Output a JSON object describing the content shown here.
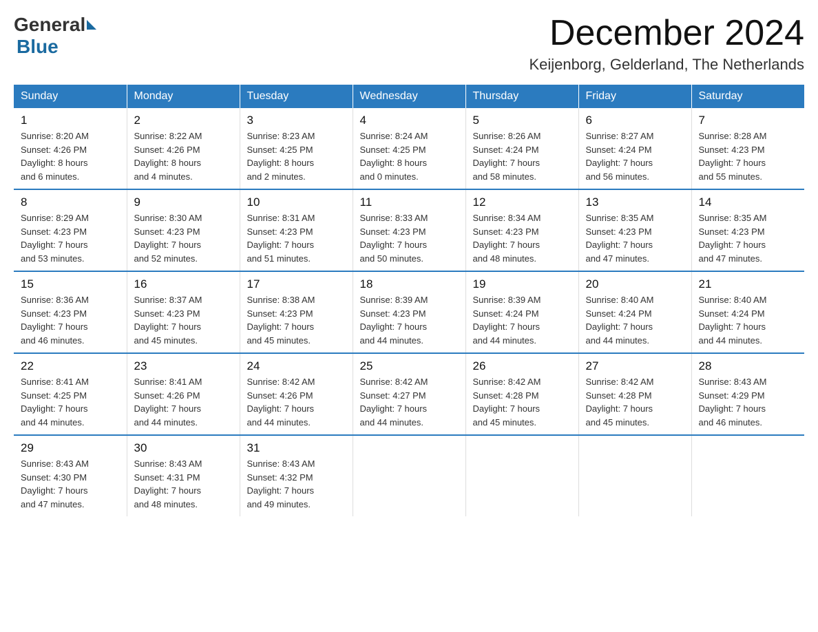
{
  "logo": {
    "general": "General",
    "blue": "Blue"
  },
  "title": {
    "month_year": "December 2024",
    "location": "Keijenborg, Gelderland, The Netherlands"
  },
  "weekdays": [
    "Sunday",
    "Monday",
    "Tuesday",
    "Wednesday",
    "Thursday",
    "Friday",
    "Saturday"
  ],
  "weeks": [
    [
      {
        "day": "1",
        "info": "Sunrise: 8:20 AM\nSunset: 4:26 PM\nDaylight: 8 hours\nand 6 minutes."
      },
      {
        "day": "2",
        "info": "Sunrise: 8:22 AM\nSunset: 4:26 PM\nDaylight: 8 hours\nand 4 minutes."
      },
      {
        "day": "3",
        "info": "Sunrise: 8:23 AM\nSunset: 4:25 PM\nDaylight: 8 hours\nand 2 minutes."
      },
      {
        "day": "4",
        "info": "Sunrise: 8:24 AM\nSunset: 4:25 PM\nDaylight: 8 hours\nand 0 minutes."
      },
      {
        "day": "5",
        "info": "Sunrise: 8:26 AM\nSunset: 4:24 PM\nDaylight: 7 hours\nand 58 minutes."
      },
      {
        "day": "6",
        "info": "Sunrise: 8:27 AM\nSunset: 4:24 PM\nDaylight: 7 hours\nand 56 minutes."
      },
      {
        "day": "7",
        "info": "Sunrise: 8:28 AM\nSunset: 4:23 PM\nDaylight: 7 hours\nand 55 minutes."
      }
    ],
    [
      {
        "day": "8",
        "info": "Sunrise: 8:29 AM\nSunset: 4:23 PM\nDaylight: 7 hours\nand 53 minutes."
      },
      {
        "day": "9",
        "info": "Sunrise: 8:30 AM\nSunset: 4:23 PM\nDaylight: 7 hours\nand 52 minutes."
      },
      {
        "day": "10",
        "info": "Sunrise: 8:31 AM\nSunset: 4:23 PM\nDaylight: 7 hours\nand 51 minutes."
      },
      {
        "day": "11",
        "info": "Sunrise: 8:33 AM\nSunset: 4:23 PM\nDaylight: 7 hours\nand 50 minutes."
      },
      {
        "day": "12",
        "info": "Sunrise: 8:34 AM\nSunset: 4:23 PM\nDaylight: 7 hours\nand 48 minutes."
      },
      {
        "day": "13",
        "info": "Sunrise: 8:35 AM\nSunset: 4:23 PM\nDaylight: 7 hours\nand 47 minutes."
      },
      {
        "day": "14",
        "info": "Sunrise: 8:35 AM\nSunset: 4:23 PM\nDaylight: 7 hours\nand 47 minutes."
      }
    ],
    [
      {
        "day": "15",
        "info": "Sunrise: 8:36 AM\nSunset: 4:23 PM\nDaylight: 7 hours\nand 46 minutes."
      },
      {
        "day": "16",
        "info": "Sunrise: 8:37 AM\nSunset: 4:23 PM\nDaylight: 7 hours\nand 45 minutes."
      },
      {
        "day": "17",
        "info": "Sunrise: 8:38 AM\nSunset: 4:23 PM\nDaylight: 7 hours\nand 45 minutes."
      },
      {
        "day": "18",
        "info": "Sunrise: 8:39 AM\nSunset: 4:23 PM\nDaylight: 7 hours\nand 44 minutes."
      },
      {
        "day": "19",
        "info": "Sunrise: 8:39 AM\nSunset: 4:24 PM\nDaylight: 7 hours\nand 44 minutes."
      },
      {
        "day": "20",
        "info": "Sunrise: 8:40 AM\nSunset: 4:24 PM\nDaylight: 7 hours\nand 44 minutes."
      },
      {
        "day": "21",
        "info": "Sunrise: 8:40 AM\nSunset: 4:24 PM\nDaylight: 7 hours\nand 44 minutes."
      }
    ],
    [
      {
        "day": "22",
        "info": "Sunrise: 8:41 AM\nSunset: 4:25 PM\nDaylight: 7 hours\nand 44 minutes."
      },
      {
        "day": "23",
        "info": "Sunrise: 8:41 AM\nSunset: 4:26 PM\nDaylight: 7 hours\nand 44 minutes."
      },
      {
        "day": "24",
        "info": "Sunrise: 8:42 AM\nSunset: 4:26 PM\nDaylight: 7 hours\nand 44 minutes."
      },
      {
        "day": "25",
        "info": "Sunrise: 8:42 AM\nSunset: 4:27 PM\nDaylight: 7 hours\nand 44 minutes."
      },
      {
        "day": "26",
        "info": "Sunrise: 8:42 AM\nSunset: 4:28 PM\nDaylight: 7 hours\nand 45 minutes."
      },
      {
        "day": "27",
        "info": "Sunrise: 8:42 AM\nSunset: 4:28 PM\nDaylight: 7 hours\nand 45 minutes."
      },
      {
        "day": "28",
        "info": "Sunrise: 8:43 AM\nSunset: 4:29 PM\nDaylight: 7 hours\nand 46 minutes."
      }
    ],
    [
      {
        "day": "29",
        "info": "Sunrise: 8:43 AM\nSunset: 4:30 PM\nDaylight: 7 hours\nand 47 minutes."
      },
      {
        "day": "30",
        "info": "Sunrise: 8:43 AM\nSunset: 4:31 PM\nDaylight: 7 hours\nand 48 minutes."
      },
      {
        "day": "31",
        "info": "Sunrise: 8:43 AM\nSunset: 4:32 PM\nDaylight: 7 hours\nand 49 minutes."
      },
      {
        "day": "",
        "info": ""
      },
      {
        "day": "",
        "info": ""
      },
      {
        "day": "",
        "info": ""
      },
      {
        "day": "",
        "info": ""
      }
    ]
  ]
}
